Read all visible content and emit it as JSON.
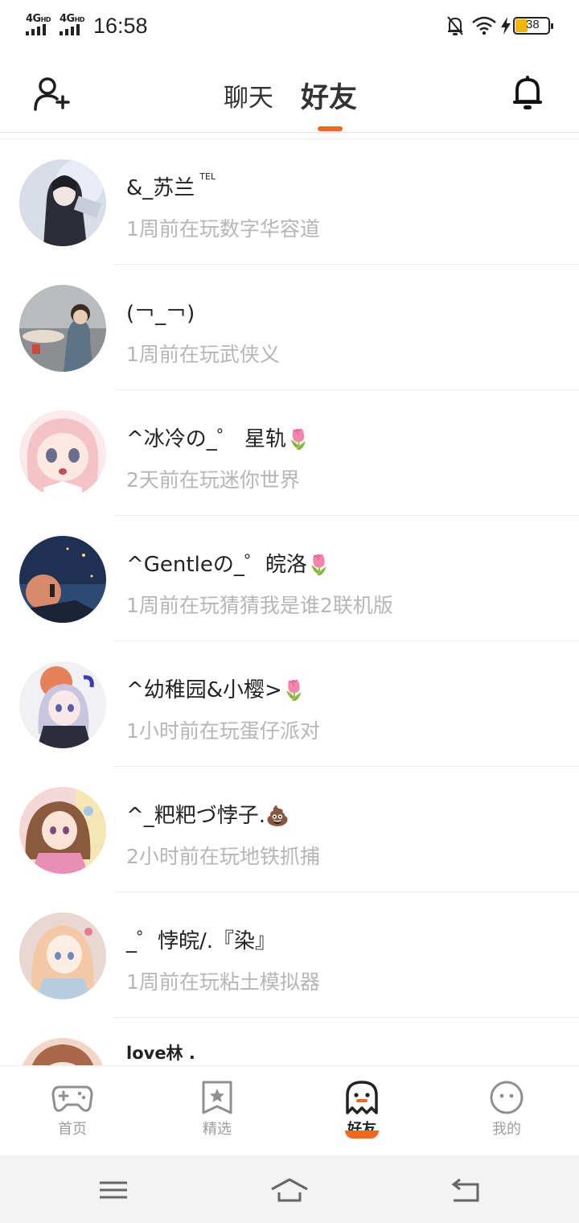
{
  "status_bar": {
    "network1": "4G",
    "network2": "4G",
    "hd": "HD",
    "time": "16:58",
    "battery": "38",
    "icons": [
      "mute-bell-icon",
      "wifi-icon",
      "charging-icon",
      "battery-icon"
    ]
  },
  "header": {
    "tabs": [
      {
        "label": "聊天",
        "active": false
      },
      {
        "label": "好友",
        "active": true
      }
    ],
    "accent_color": "#f5651e"
  },
  "friends": [
    {
      "name": "&_苏兰",
      "tag": "TEL",
      "status": "1周前在玩数字华容道"
    },
    {
      "name": "(￢_￢)",
      "status": "1周前在玩武侠义"
    },
    {
      "name": "^冰冷の_゜ 星轨",
      "emoji": "🌷",
      "status": "2天前在玩迷你世界"
    },
    {
      "name": "^Gentleの_゜皖洛",
      "emoji": "🌷",
      "status": "1周前在玩猜猜我是谁2联机版"
    },
    {
      "name": "^幼稚园&小樱>",
      "emoji": "🌷",
      "status": "1小时前在玩蛋仔派对"
    },
    {
      "name": "^_粑粑づ悖子.",
      "emoji": "💩",
      "status": "2小时前在玩地铁抓捕"
    },
    {
      "name": "_゜悖皖/.『染』",
      "status": "1周前在玩粘土模拟器"
    },
    {
      "name": "love林 .",
      "status": ""
    }
  ],
  "bottom_nav": [
    {
      "label": "首页",
      "icon": "gamepad-icon",
      "active": false
    },
    {
      "label": "精选",
      "icon": "star-bookmark-icon",
      "active": false
    },
    {
      "label": "好友",
      "icon": "ghost-icon",
      "active": true
    },
    {
      "label": "我的",
      "icon": "smiley-face-icon",
      "active": false
    }
  ]
}
